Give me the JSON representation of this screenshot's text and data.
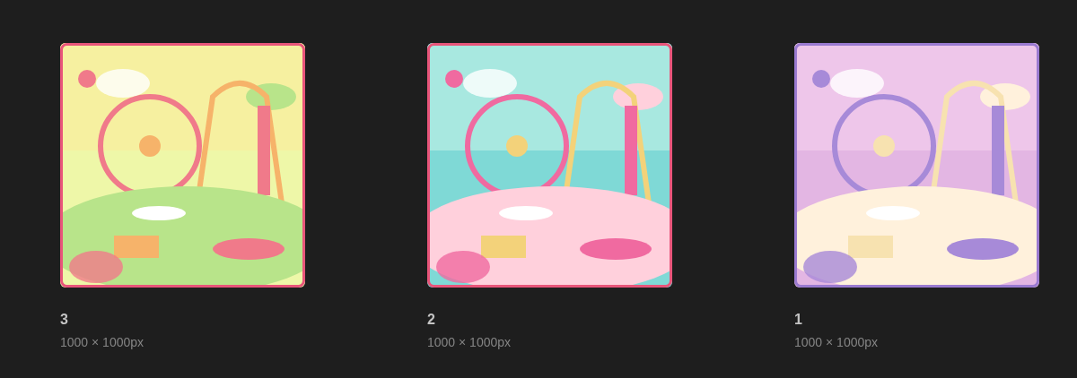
{
  "assets": [
    {
      "kind": "picture",
      "name": "3",
      "size": "1000 × 1000px"
    },
    {
      "kind": "picture",
      "name": "2",
      "size": "1000 × 1000px"
    },
    {
      "kind": "picture",
      "name": "1",
      "size": "1000 × 1000px"
    }
  ]
}
